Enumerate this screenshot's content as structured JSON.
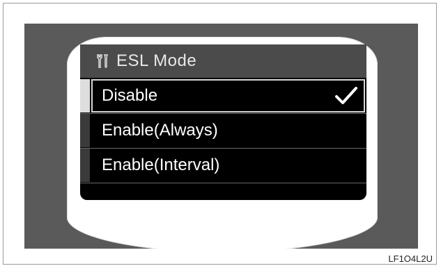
{
  "screen": {
    "title": "ESL Mode",
    "title_icon": "wrench-screwdriver-icon",
    "items": [
      {
        "label": "Disable",
        "selected": true
      },
      {
        "label": "Enable(Always)",
        "selected": false
      },
      {
        "label": "Enable(Interval)",
        "selected": false
      }
    ],
    "check_icon": "checkmark-icon"
  },
  "caption": "LF1O4L2U",
  "colors": {
    "display_bg": "#000000",
    "title_bar": "#4b4b4b",
    "surround": "#5a5a5a",
    "bezel": "#ffffff"
  }
}
